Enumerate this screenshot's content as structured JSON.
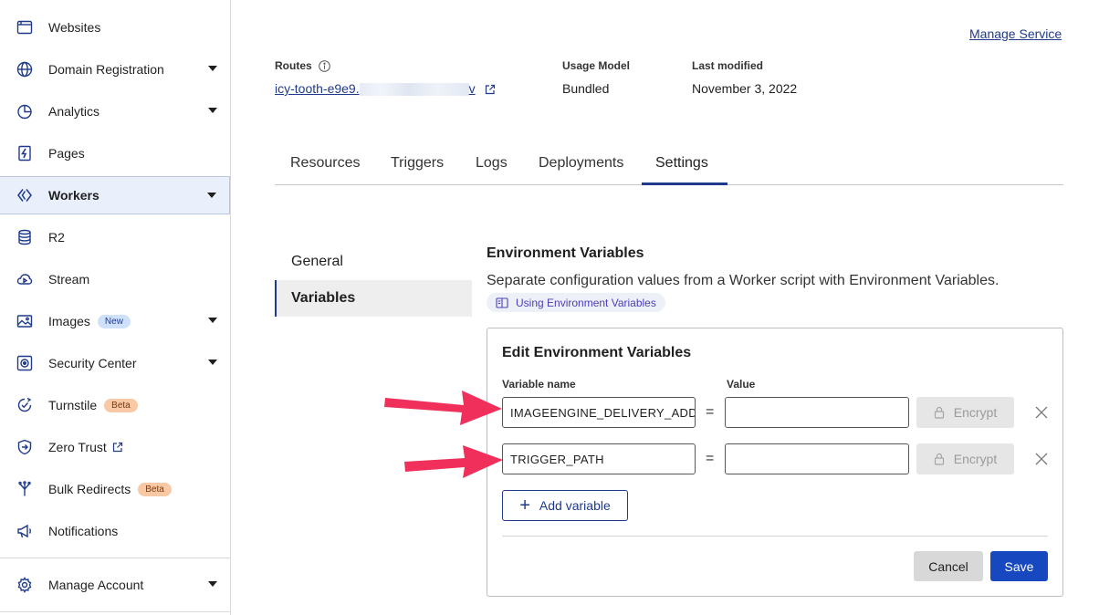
{
  "sidebar": {
    "items": [
      {
        "label": "Websites",
        "icon": "browser-window-icon"
      },
      {
        "label": "Domain Registration",
        "icon": "globe-icon"
      },
      {
        "label": "Analytics",
        "icon": "pie-chart-icon"
      },
      {
        "label": "Pages",
        "icon": "lightning-page-icon"
      },
      {
        "label": "Workers",
        "icon": "workers-diamond-icon"
      },
      {
        "label": "R2",
        "icon": "database-icon"
      },
      {
        "label": "Stream",
        "icon": "stream-cloud-icon"
      },
      {
        "label": "Images",
        "icon": "image-icon",
        "badge": "New"
      },
      {
        "label": "Security Center",
        "icon": "security-center-icon"
      },
      {
        "label": "Turnstile",
        "icon": "turnstile-icon",
        "badge": "Beta"
      },
      {
        "label": "Zero Trust",
        "icon": "zero-trust-shield-icon"
      },
      {
        "label": "Bulk Redirects",
        "icon": "redirect-fork-icon",
        "badge": "Beta"
      },
      {
        "label": "Notifications",
        "icon": "megaphone-icon"
      }
    ],
    "footer": {
      "label": "Manage Account",
      "icon": "gear-icon"
    }
  },
  "header": {
    "manage_service": "Manage Service",
    "routes_label": "Routes",
    "route_prefix": "icy-tooth-e9e9.",
    "route_suffix": "v",
    "usage_model_label": "Usage Model",
    "usage_model_value": "Bundled",
    "last_modified_label": "Last modified",
    "last_modified_value": "November 3, 2022"
  },
  "tabs": [
    "Resources",
    "Triggers",
    "Logs",
    "Deployments",
    "Settings"
  ],
  "active_tab": "Settings",
  "subnav": [
    "General",
    "Variables"
  ],
  "env": {
    "title": "Environment Variables",
    "description": "Separate configuration values from a Worker script with Environment Variables.",
    "doc_link": "Using Environment Variables",
    "card_title": "Edit Environment Variables",
    "col_name": "Variable name",
    "col_value": "Value",
    "rows": [
      {
        "name": "IMAGEENGINE_DELIVERY_ADDRESS",
        "value": "",
        "encrypt": "Encrypt"
      },
      {
        "name": "TRIGGER_PATH",
        "value": "",
        "encrypt": "Encrypt"
      }
    ],
    "equals": "=",
    "add_variable": "Add variable",
    "cancel": "Cancel",
    "save": "Save"
  },
  "colors": {
    "accent": "#1f3a8a",
    "save": "#1748c0",
    "annotation_arrow": "#f0305a"
  }
}
